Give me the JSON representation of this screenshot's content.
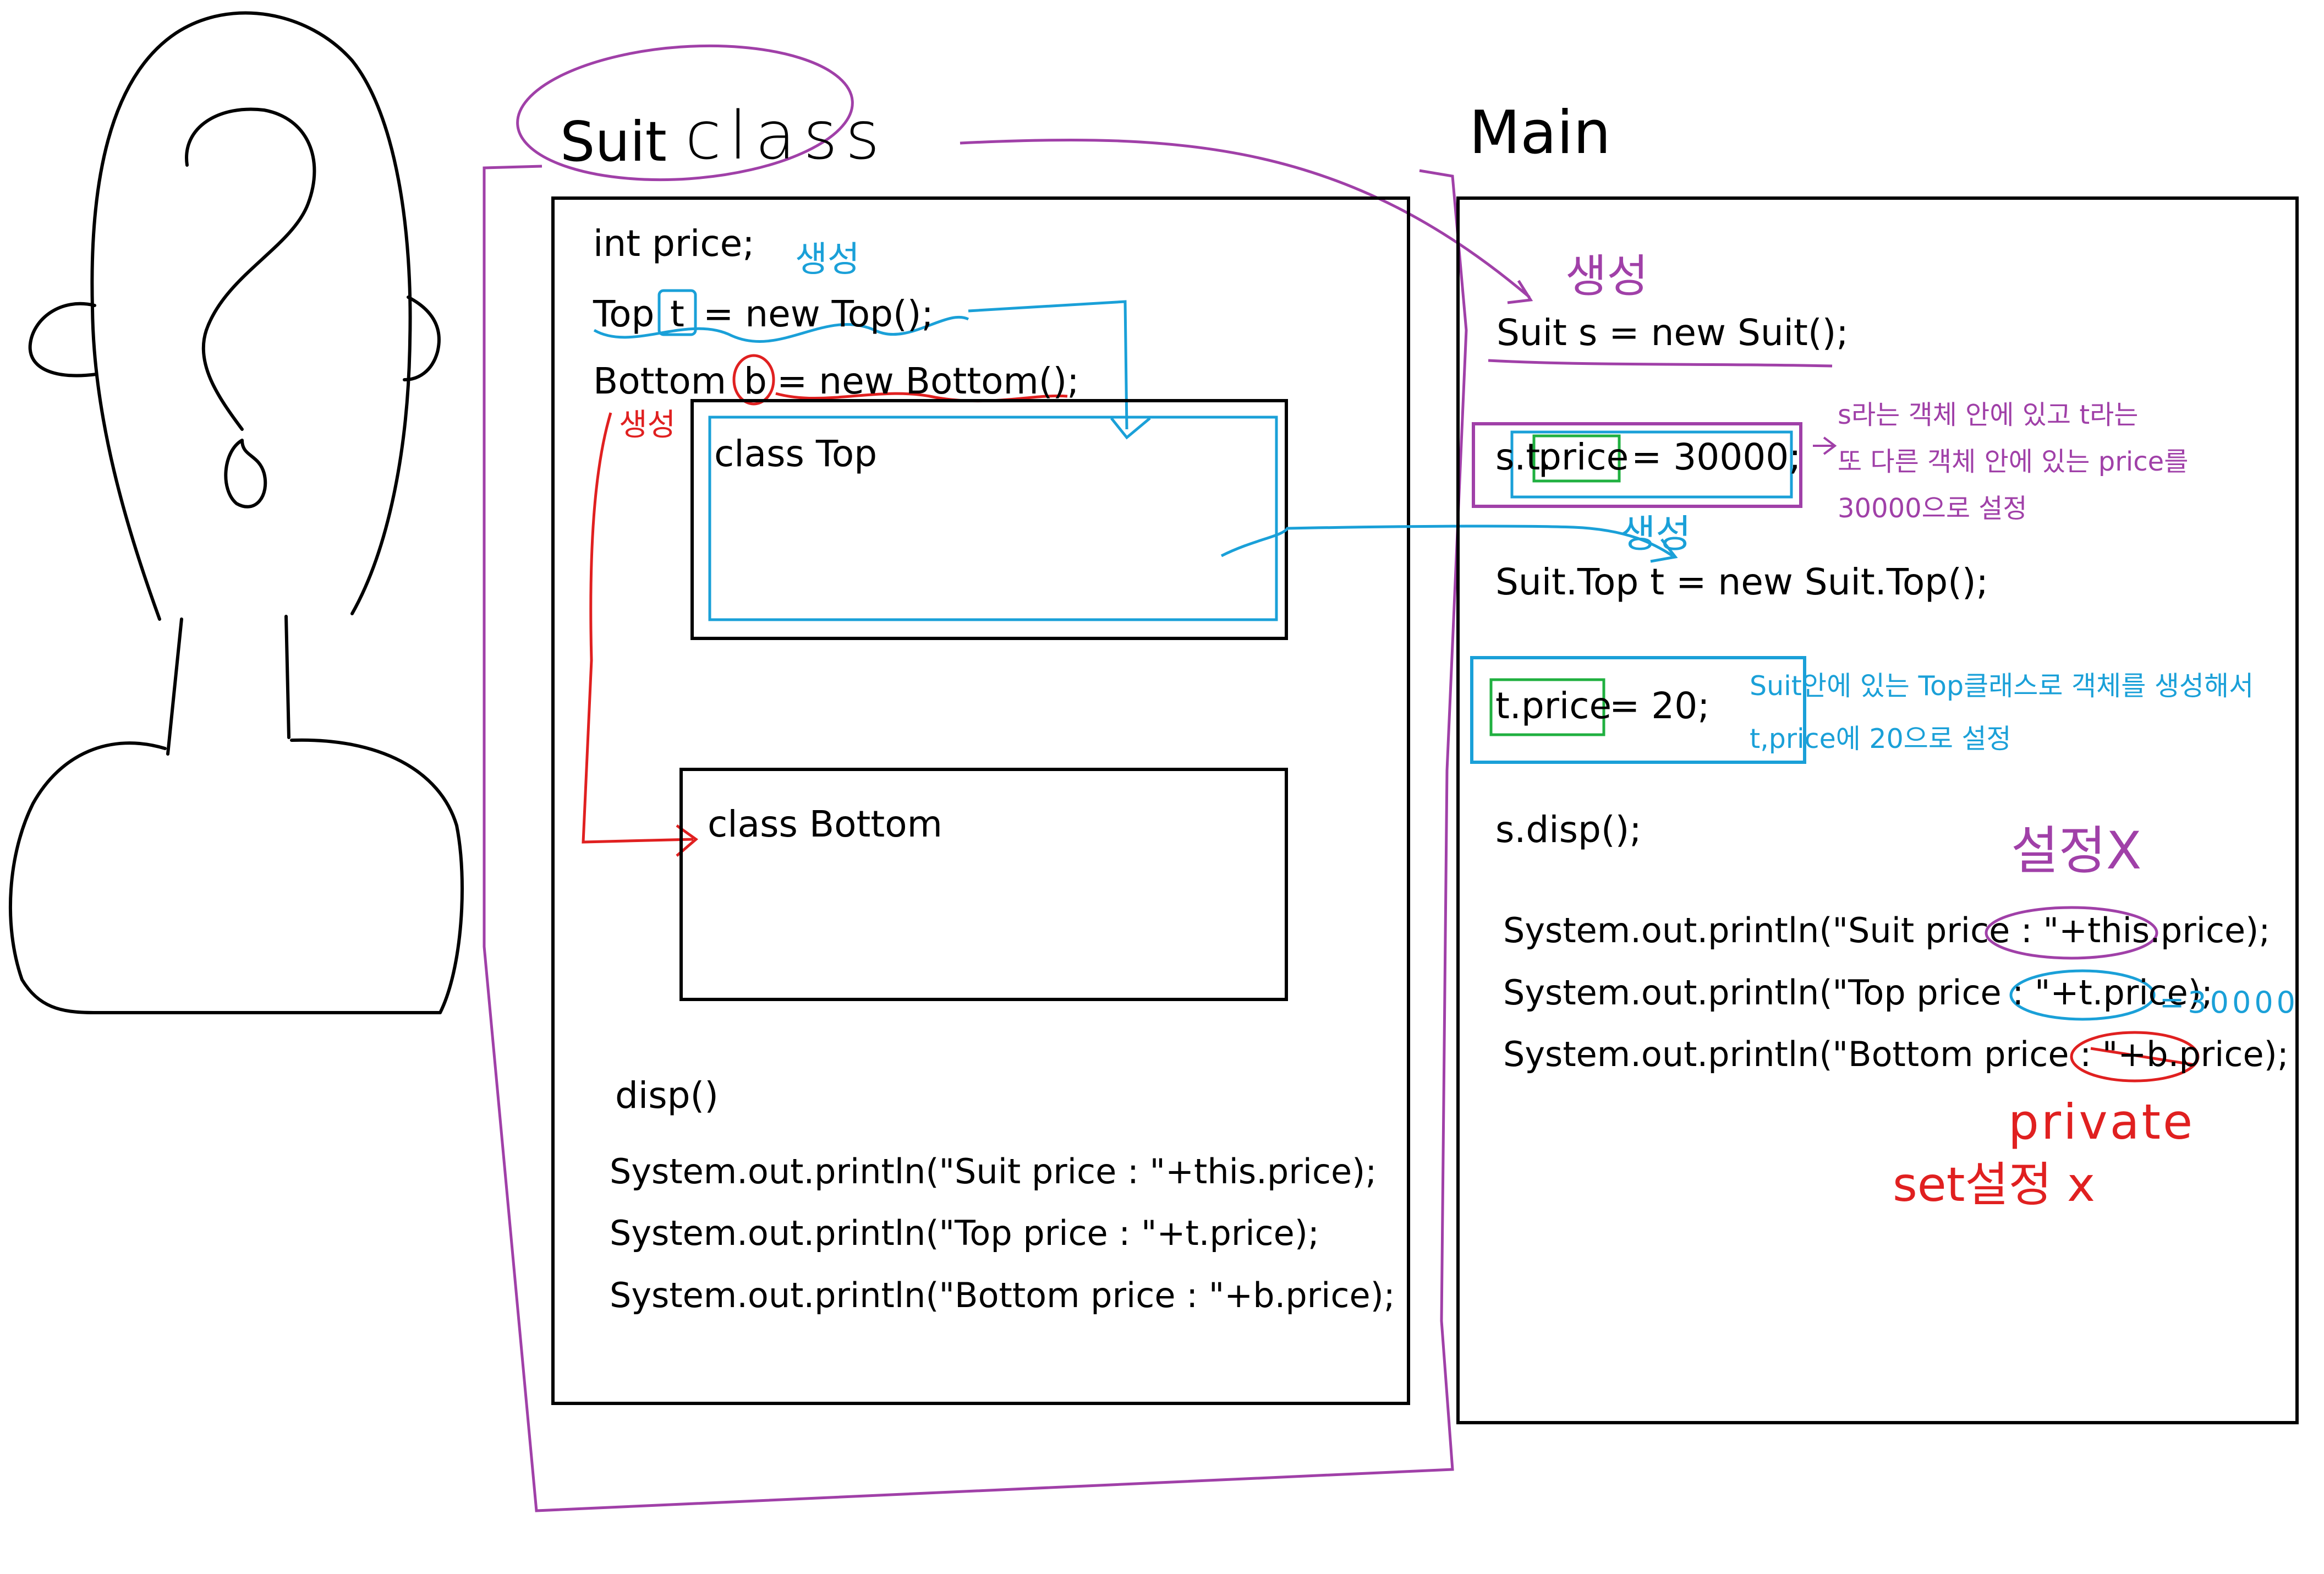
{
  "colors": {
    "ink": "#000000",
    "purple": "#a040a8",
    "blue": "#1aa0d8",
    "red": "#e02020",
    "green": "#20b040"
  },
  "icons": {
    "head": "question-head-doodle"
  },
  "suit": {
    "title_printed": "Suit",
    "title_hand": "class",
    "field_price": "int price;",
    "field_top_pre": "Top",
    "field_top_var": "t",
    "field_top_post": "= new Top();",
    "field_bottom_pre": "Bottom",
    "field_bottom_var": "b",
    "field_bottom_post": "= new Bottom();",
    "note_create_top": "생성",
    "note_create_bottom": "생성",
    "class_top": "class Top",
    "class_bottom": "class Bottom",
    "method": "disp()",
    "print_lines": [
      "System.out.println(\"Suit price : \"+this.price);",
      "System.out.println(\"Top price : \"+t.price);",
      "System.out.println(\"Bottom price : \"+b.price);"
    ]
  },
  "main": {
    "title": "Main",
    "note_create_suit": "생성",
    "line_new_suit": "Suit s = new Suit();",
    "line_set_price_pre": "s.t.",
    "line_set_price_field": "price",
    "line_set_price_post": "= 30000;",
    "note_set_price": [
      "s라는 객체 안에 있고 t라는",
      "또 다른 객체 안에 있는 price를",
      "30000으로 설정"
    ],
    "note_create_top": "생성",
    "line_new_top": "Suit.Top t = new Suit.Top();",
    "line_t_price_field": "t.price",
    "line_t_price_post": "= 20;",
    "note_t_price": [
      "Suit안에 있는 Top클래스로 객체를 생성해서",
      "t,price에 20으로 설정"
    ],
    "line_disp": "s.disp();",
    "note_setting_x": "설정X",
    "print_prefixes": [
      "System.out.println(\"Suit price : \"",
      "System.out.println(\"Top price : \"",
      "System.out.println(\"Bottom price : \""
    ],
    "print_args": [
      "+this.price",
      "+t.price",
      "+b.price"
    ],
    "print_suffixes": [
      ");",
      ");",
      ");"
    ],
    "note_30000": "=30000",
    "note_private": "private",
    "note_set_x": "set설정 x"
  }
}
